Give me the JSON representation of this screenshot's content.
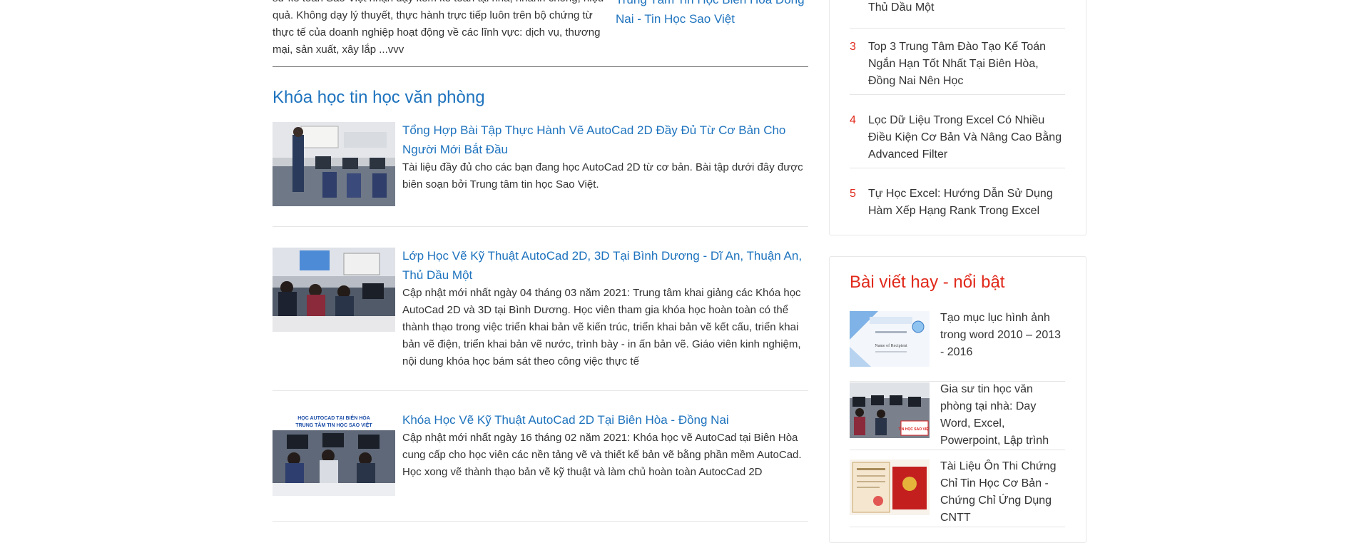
{
  "top": {
    "excerpt": "sư kế toán Sao Việt nhận dạy kèm kế toán tại nhà, nhanh chóng, hiệu quả. Không dạy lý thuyết, thực hành trực tiếp luôn trên bộ chứng từ thực tế của doanh nghiệp hoạt động về các lĩnh vực: dịch vụ, thương mại, sản xuất, xây lắp ...vvv",
    "link": "Trung Tâm Tin Học Biên Hòa Đồng Nai - Tin Học Sao Việt"
  },
  "section": {
    "title": "Khóa học tin học văn phòng"
  },
  "posts": [
    {
      "title": "Tổng Hợp Bài Tập Thực Hành Vẽ AutoCad 2D Đầy Đủ Từ Cơ Bản Cho Người Mới Bắt Đầu",
      "excerpt": "Tài liệu đầy đủ cho các bạn đang học AutoCad 2D từ cơ bản. Bài tập dưới đây được biên soạn bởi Trung tâm tin học Sao Việt."
    },
    {
      "title": "Lớp Học Vẽ Kỹ Thuật AutoCad 2D, 3D Tại Bình Dương - Dĩ An, Thuận An, Thủ Dầu Một",
      "excerpt": "Cập nhật mới nhất ngày 04 tháng 03 năm 2021: Trung tâm khai giảng các Khóa học AutoCad 2D và 3D tại Bình Dương. Học viên tham gia khóa học hoàn toàn có thể thành thạo trong việc triển khai bản vẽ kiến trúc, triển khai bản vẽ kết cấu, triển khai bản vẽ điện, triển khai bản vẽ nước, trình bày - in ấn bản vẽ. Giáo viên kinh nghiệm, nội dung khóa học bám sát theo công việc thực tế"
    },
    {
      "title": "Khóa Học Vẽ Kỹ Thuật AutoCad 2D Tại Biên Hòa - Đồng Nai",
      "excerpt": "Cập nhật mới nhất ngày 16 tháng 02 năm 2021: Khóa học vẽ AutoCad tại Biên Hòa cung cấp cho học viên các nền tảng vẽ và thiết kế bản vẽ bằng phần mềm AutoCad. Học xong vẽ thành thạo bản vẽ kỹ thuật và làm chủ hoàn toàn AutocCad 2D",
      "thumb_caption": "HỌC AUTOCAD TẠI BIÊN HÒA TRUNG TÂM TIN HỌC SAO VIỆT"
    }
  ],
  "ranked": [
    {
      "num": "",
      "text": "Thủ Dầu Một"
    },
    {
      "num": "3",
      "text": "Top 3 Trung Tâm Đào Tạo Kế Toán Ngắn Hạn Tốt Nhất Tại Biên Hòa, Đồng Nai Nên Học"
    },
    {
      "num": "4",
      "text": "Lọc Dữ Liệu Trong Excel Có Nhiều Điều Kiện Cơ Bản Và Nâng Cao Bằng Advanced Filter"
    },
    {
      "num": "5",
      "text": "Tự Học Excel: Hướng Dẫn Sử Dụng Hàm Xếp Hạng Rank Trong Excel"
    }
  ],
  "featured": {
    "title": "Bài viết hay - nổi bật",
    "items": [
      {
        "text": "Tạo mục lục hình ảnh trong word 2010 – 2013 - 2016",
        "thumb_caption": "Name of Recipient"
      },
      {
        "text": "Gia sư tin học văn phòng tại nhà: Day Word, Excel, Powerpoint, Lập trình",
        "thumb_caption": "TIN HỌC SAO VIỆT"
      },
      {
        "text": "Tài Liệu Ôn Thi Chứng Chỉ Tin Học Cơ Bản - Chứng Chỉ Ứng Dụng CNTT"
      }
    ]
  },
  "colors": {
    "link": "#1e73be",
    "accent_red": "#e0291b",
    "text": "#333333"
  }
}
